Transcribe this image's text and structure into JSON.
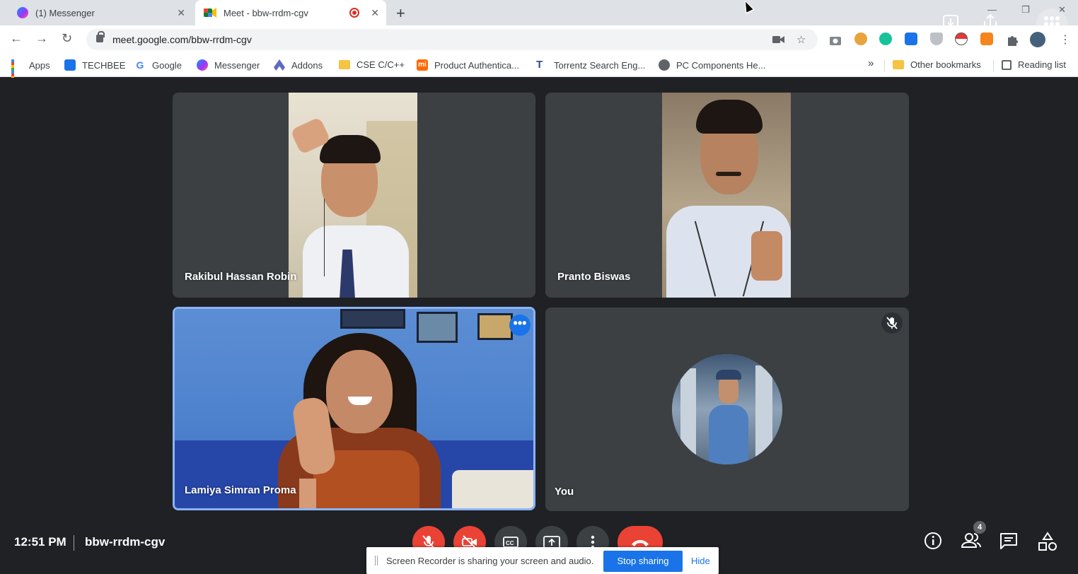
{
  "browser": {
    "tabs": [
      {
        "label": "(1) Messenger",
        "active": false
      },
      {
        "label": "Meet - bbw-rrdm-cgv",
        "active": true
      }
    ],
    "url": "meet.google.com/bbw-rrdm-cgv",
    "bookmarks": [
      {
        "label": "Apps",
        "icon": "apps-grid-icon"
      },
      {
        "label": "TECHBEE",
        "icon": "wifi-icon"
      },
      {
        "label": "Google",
        "icon": "google-icon"
      },
      {
        "label": "Messenger",
        "icon": "messenger-icon"
      },
      {
        "label": "Addons",
        "icon": "addons-icon"
      },
      {
        "label": "CSE C/C++",
        "icon": "folder-icon"
      },
      {
        "label": "Product Authentica...",
        "icon": "mi-icon"
      },
      {
        "label": "Torrentz Search Eng...",
        "icon": "torrentz-icon"
      },
      {
        "label": "PC Components He...",
        "icon": "globe-icon"
      }
    ],
    "overflow_label": "»",
    "other_bookmarks": "Other bookmarks",
    "reading_list": "Reading list"
  },
  "meet": {
    "participants": [
      {
        "name": "Rakibul Hassan Robin"
      },
      {
        "name": "Pranto Biswas"
      },
      {
        "name": "Lamiya Simran Proma"
      },
      {
        "name": "You"
      }
    ],
    "more_options_glyph": "•••",
    "time": "12:51 PM",
    "meeting_code": "bbw-rrdm-cgv",
    "participant_count": "4",
    "screen_share": {
      "message": "Screen Recorder is sharing your screen and audio.",
      "stop_label": "Stop sharing",
      "hide_label": "Hide"
    }
  },
  "colors": {
    "meet_background": "#202124",
    "tile_background": "#3c4043",
    "danger": "#ea4335",
    "accent": "#1a73e8",
    "selected_outline": "#8ab4f8"
  }
}
